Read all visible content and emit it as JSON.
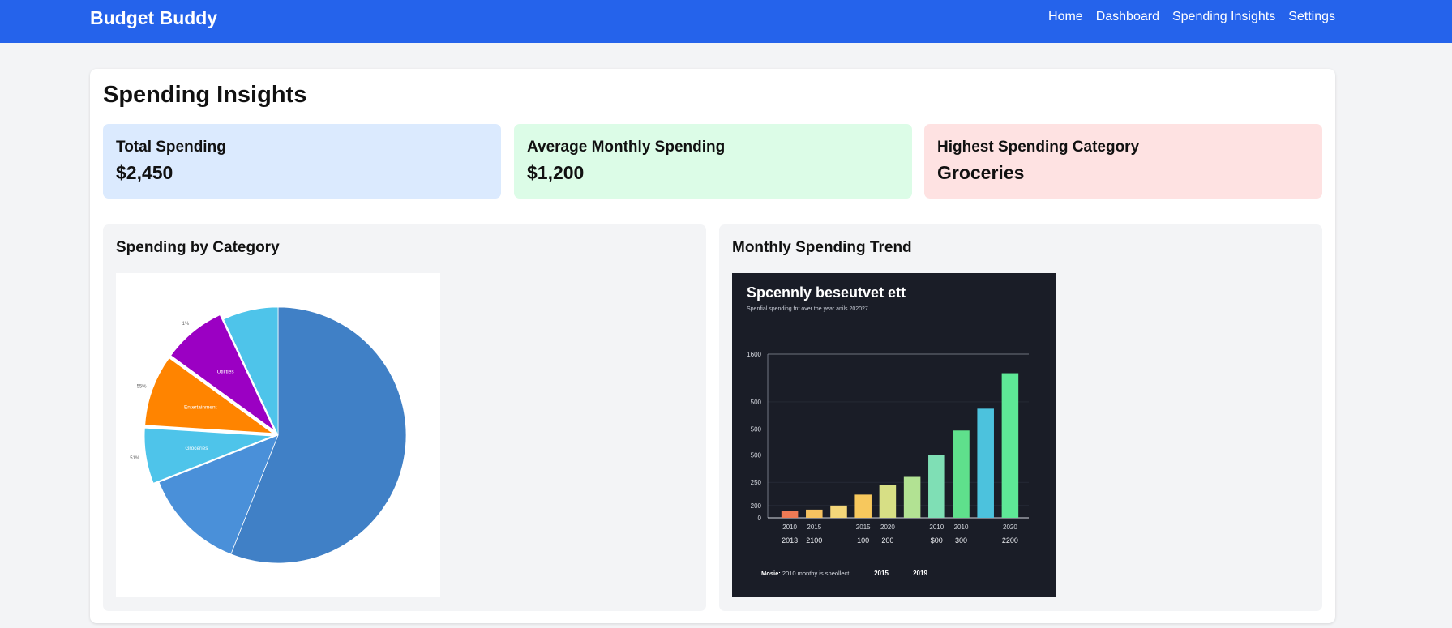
{
  "nav": {
    "brand": "Budget Buddy",
    "links": [
      "Home",
      "Dashboard",
      "Spending Insights",
      "Settings"
    ]
  },
  "page": {
    "title": "Spending Insights"
  },
  "stats": [
    {
      "label": "Total Spending",
      "value": "$2,450"
    },
    {
      "label": "Average Monthly Spending",
      "value": "$1,200"
    },
    {
      "label": "Highest Spending Category",
      "value": "Groceries"
    }
  ],
  "colors": {
    "nav_bg": "#2563eb",
    "stat_blue": "#dbeafe",
    "stat_green": "#dcfce7",
    "stat_red": "#fee2e2"
  },
  "panels": {
    "category": {
      "title": "Spending by Category"
    },
    "trend": {
      "title": "Monthly Spending Trend"
    }
  },
  "pie_image": {
    "slice_labels": [
      "Groceries",
      "Entertainment",
      "Utilities"
    ],
    "pct_labels": [
      "51%",
      "55%",
      "1%"
    ]
  },
  "bar_image": {
    "title": "Spcennly beseutvet ett",
    "subtitle": "Spenfial spending fnt over the year anils 202027.",
    "y_ticks": [
      "1600",
      "500",
      "500",
      "500",
      "250",
      "200",
      "0"
    ],
    "x_labels_row1": [
      "2010",
      "2015",
      "2015",
      "2020",
      "2010",
      "2010",
      "2020"
    ],
    "x_labels_row2": [
      "2013",
      "2100",
      "100",
      "200",
      "$00",
      "300",
      "2200"
    ],
    "footer": {
      "note_bold": "Mosie:",
      "note": "2010 monthy is speollect.",
      "mark1": "2015",
      "mark2": "2019"
    }
  },
  "chart_data": [
    {
      "type": "pie",
      "title": "",
      "categories": [
        "",
        "",
        "Groceries",
        "Entertainment",
        "Utilities",
        ""
      ],
      "values": [
        56,
        13,
        7,
        9,
        8,
        7
      ],
      "value_unit": "approximate share read from slice angles (%)",
      "slice_labels": [
        "",
        "",
        "Groceries",
        "Entertainment",
        "Utilities",
        ""
      ],
      "pct_labels": [
        "",
        "",
        "51%",
        "55%",
        "1%",
        ""
      ],
      "colors": [
        "#4080c6",
        "#4a90d9",
        "#4ec4ea",
        "#ff8400",
        "#9b00c3",
        "#4ec4ea"
      ],
      "exploded": [
        false,
        false,
        true,
        true,
        true,
        false
      ]
    },
    {
      "type": "bar",
      "title": "Spcennly beseutvet ett",
      "subtitle": "Spenfial spending fnt over the year anils 202027.",
      "categories": [
        "2010",
        "2015",
        "",
        "2015",
        "2020",
        "",
        "2010",
        "2010",
        "",
        "2020"
      ],
      "values": [
        0.5,
        0.6,
        0.9,
        1.7,
        2.4,
        3.0,
        4.6,
        6.4,
        8.0,
        10.6
      ],
      "value_unit": "y-axis gridline steps (printed tick labels are not monotonic)",
      "ylim": [
        0,
        12
      ],
      "y_ticks": [
        "1600",
        "500",
        "500",
        "500",
        "250",
        "200",
        "0"
      ],
      "colors": [
        "#ef7a55",
        "#f6c260",
        "#f4d77a",
        "#f7c85d",
        "#d7df85",
        "#b2e293",
        "#7fdfb5",
        "#5fe08c",
        "#4cc2dd",
        "#5ee896"
      ],
      "grid": true,
      "legend": "none"
    }
  ]
}
